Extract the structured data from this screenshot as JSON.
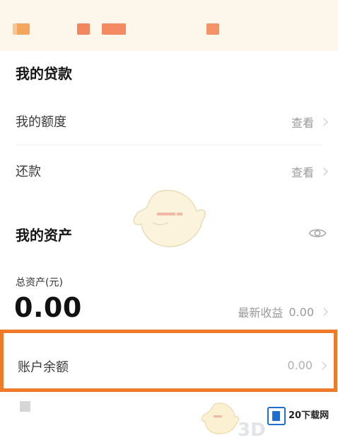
{
  "loans": {
    "title": "我的贷款",
    "rows": [
      {
        "label": "我的额度",
        "action": "查看"
      },
      {
        "label": "还款",
        "action": "查看"
      }
    ]
  },
  "assets": {
    "title": "我的资产",
    "visibility_icon": "eye-icon",
    "total_label": "总资产(元)",
    "total_amount": "0.00",
    "latest_income_label": "最新收益",
    "latest_income_value": "0.00"
  },
  "balance": {
    "label": "账户余额",
    "value": "0.00",
    "highlight_color": "#ee7a2a"
  },
  "watermark": {
    "text": "3D",
    "logo_text": "20下载网"
  }
}
